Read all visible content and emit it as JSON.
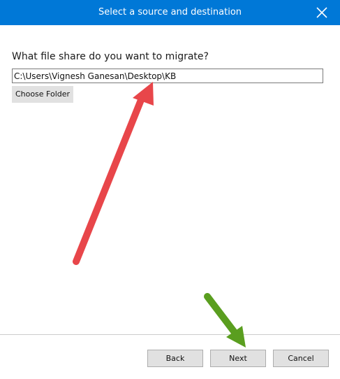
{
  "window": {
    "title": "Select a source and destination",
    "close_icon": "close-icon",
    "title_bar_color": "#0078d7"
  },
  "main": {
    "prompt": "What file share do you want to migrate?",
    "path_value": "C:\\Users\\Vignesh Ganesan\\Desktop\\KB",
    "choose_folder_label": "Choose Folder"
  },
  "footer": {
    "back_label": "Back",
    "next_label": "Next",
    "cancel_label": "Cancel"
  },
  "annotations": {
    "red_arrow_color": "#e8464a",
    "green_arrow_color": "#5a9e1f"
  }
}
